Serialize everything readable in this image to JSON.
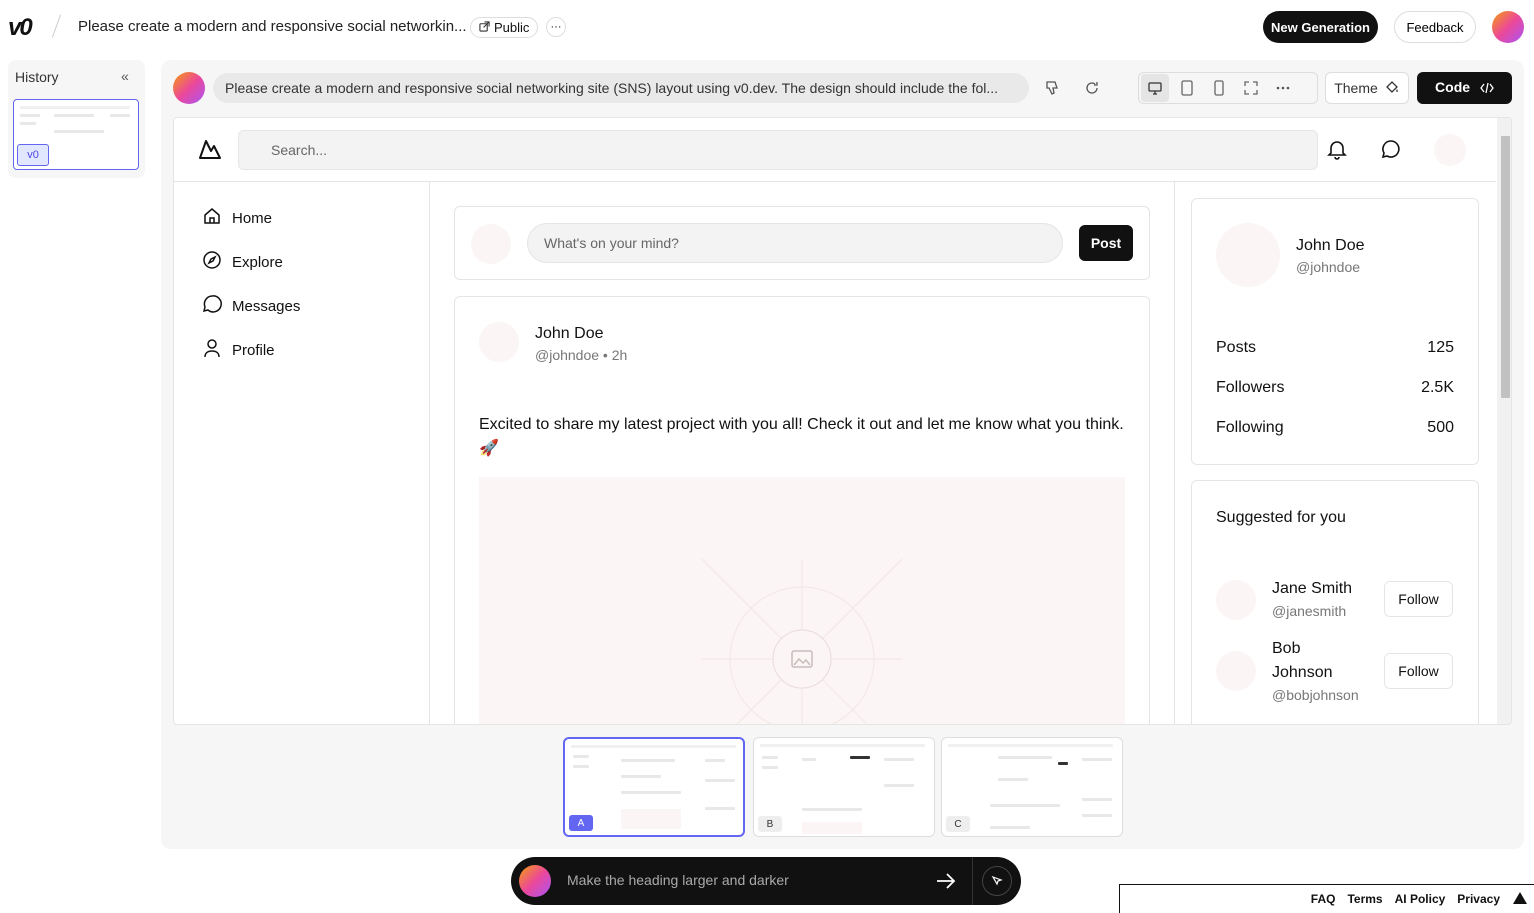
{
  "topbar": {
    "logo": "v0",
    "project_title": "Please create a modern and responsive social networkin...",
    "visibility": "Public",
    "more": "···",
    "new_generation": "New Generation",
    "feedback": "Feedback"
  },
  "history": {
    "label": "History",
    "collapse": "«",
    "version_label": "v0"
  },
  "prompt": {
    "text": "Please create a modern and responsive social networking site (SNS) layout using v0.dev. The design should include the fol..."
  },
  "toolbar": {
    "theme": "Theme",
    "code": "Code"
  },
  "app": {
    "search_placeholder": "Search...",
    "nav": [
      {
        "label": "Home",
        "icon": "home-icon"
      },
      {
        "label": "Explore",
        "icon": "compass-icon"
      },
      {
        "label": "Messages",
        "icon": "message-icon"
      },
      {
        "label": "Profile",
        "icon": "user-icon"
      }
    ],
    "composer": {
      "placeholder": "What's on your mind?",
      "post_label": "Post"
    },
    "post": {
      "author": "John Doe",
      "handle": "@johndoe",
      "time": "2h",
      "meta": "@johndoe • 2h",
      "text": "Excited to share my latest project with you all! Check it out and let me know what you think. 🚀"
    },
    "profile": {
      "name": "John Doe",
      "handle": "@johndoe",
      "stats": [
        {
          "label": "Posts",
          "value": "125"
        },
        {
          "label": "Followers",
          "value": "2.5K"
        },
        {
          "label": "Following",
          "value": "500"
        }
      ]
    },
    "suggested": {
      "title": "Suggested for you",
      "follow_label": "Follow",
      "users": [
        {
          "name": "Jane Smith",
          "handle": "@janesmith"
        },
        {
          "name": "Bob Johnson",
          "handle": "@bobjohnson"
        }
      ]
    }
  },
  "versions": [
    {
      "label": "A",
      "active": true
    },
    {
      "label": "B",
      "active": false
    },
    {
      "label": "C",
      "active": false
    }
  ],
  "chat": {
    "placeholder": "Make the heading larger and darker"
  },
  "footer": {
    "links": [
      "FAQ",
      "Terms",
      "AI Policy",
      "Privacy"
    ]
  },
  "colors": {
    "accent": "#6366f1",
    "dark": "#111111",
    "avatar_placeholder": "#fbf5f5"
  }
}
